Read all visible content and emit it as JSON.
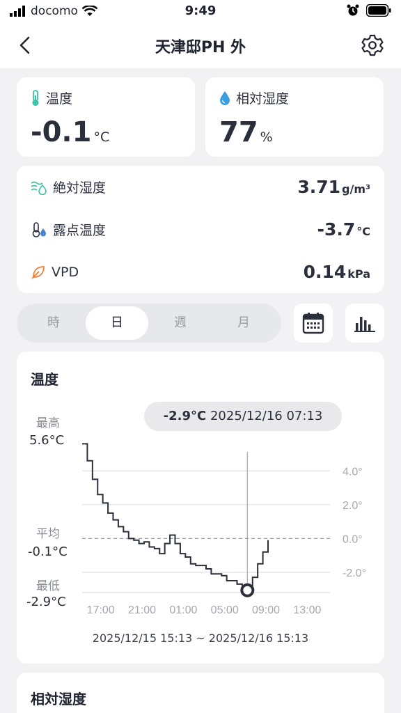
{
  "status_bar": {
    "carrier": "docomo",
    "time": "9:49"
  },
  "nav": {
    "title": "天津邸PH 外"
  },
  "temperature": {
    "label": "温度",
    "value": "-0.1",
    "unit": "°C"
  },
  "humidity": {
    "label": "相対湿度",
    "value": "77",
    "unit": "%"
  },
  "metrics": [
    {
      "label": "絶対湿度",
      "value": "3.71",
      "unit": "g/m³",
      "icon": "absolute-humidity-icon",
      "color": "#3cc0a6"
    },
    {
      "label": "露点温度",
      "value": "-3.7",
      "unit": "°C",
      "icon": "dew-point-icon",
      "color": "#4a7fd0"
    },
    {
      "label": "VPD",
      "value": "0.14",
      "unit": "kPa",
      "icon": "leaf-icon",
      "color": "#f07a2a"
    }
  ],
  "period_tabs": [
    "時",
    "日",
    "週",
    "月"
  ],
  "active_tab": "日",
  "chart_card": {
    "title": "温度",
    "max_label": "最高",
    "max_value": "5.6°C",
    "avg_label": "平均",
    "avg_value": "-0.1°C",
    "min_label": "最低",
    "min_value": "-2.9°C",
    "tooltip_value": "-2.9°C",
    "tooltip_time": "2025/12/16 07:13",
    "range": "2025/12/15 15:13 ~ 2025/12/16 15:13"
  },
  "chart_data": {
    "type": "line",
    "x_ticks": [
      "17:00",
      "21:00",
      "01:00",
      "05:00",
      "09:00",
      "13:00"
    ],
    "y_ticks": [
      "4.0°",
      "2.0°",
      "0.0°",
      "-2.0°"
    ],
    "y_tick_values": [
      4,
      2,
      0,
      -2
    ],
    "ylim": [
      -3.2,
      5.7
    ],
    "xlim": [
      15.2,
      39.2
    ],
    "x_tick_hours": [
      17,
      21,
      25,
      29,
      33,
      37
    ],
    "average": -0.1,
    "cursor_x": 31.2,
    "x": [
      15.2,
      15.7,
      16.2,
      16.7,
      17.2,
      17.7,
      18.2,
      18.7,
      19.2,
      19.7,
      20.2,
      20.7,
      21.2,
      21.7,
      22.2,
      22.7,
      23.2,
      23.7,
      24.2,
      24.7,
      25.2,
      25.7,
      26.2,
      26.7,
      27.2,
      27.7,
      28.2,
      28.7,
      29.2,
      29.7,
      30.2,
      30.7,
      31.2,
      31.7,
      32.2,
      32.7,
      33.2
    ],
    "y": [
      5.6,
      4.6,
      3.5,
      2.6,
      2.1,
      1.5,
      1.1,
      0.7,
      0.4,
      0.0,
      -0.1,
      -0.3,
      -0.2,
      -0.5,
      -0.6,
      -0.9,
      -0.3,
      0.2,
      -0.3,
      -0.9,
      -1.1,
      -1.5,
      -1.6,
      -1.6,
      -1.8,
      -2.1,
      -2.1,
      -2.2,
      -2.5,
      -2.5,
      -2.7,
      -2.8,
      -2.9,
      -2.3,
      -1.5,
      -0.8,
      -0.1
    ],
    "line_color": "#2b2f3c"
  },
  "next_card": {
    "title": "相対湿度"
  }
}
